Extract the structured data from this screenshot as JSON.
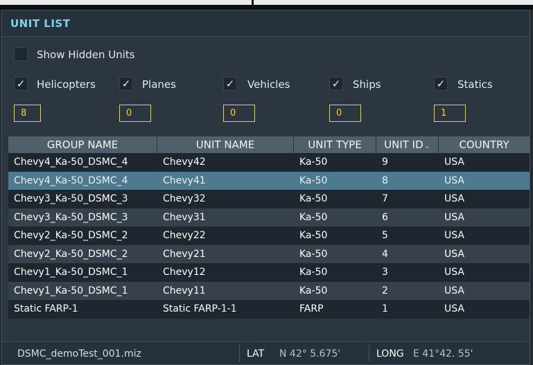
{
  "window": {
    "title": "UNIT LIST"
  },
  "filters": {
    "show_hidden": {
      "label": "Show Hidden Units",
      "checked": false
    },
    "categories": [
      {
        "label": "Helicopters",
        "checked": true,
        "count": "8"
      },
      {
        "label": "Planes",
        "checked": true,
        "count": "0"
      },
      {
        "label": "Vehicles",
        "checked": true,
        "count": "0"
      },
      {
        "label": "Ships",
        "checked": true,
        "count": "0"
      },
      {
        "label": "Statics",
        "checked": true,
        "count": "1"
      }
    ]
  },
  "table": {
    "columns": [
      "GROUP NAME",
      "UNIT NAME",
      "UNIT TYPE",
      "UNIT ID",
      "COUNTRY"
    ],
    "sort_indicator": "⌄",
    "rows": [
      [
        "Chevy4_Ka-50_DSMC_4",
        "Chevy42",
        "Ka-50",
        "9",
        "USA"
      ],
      [
        "Chevy4_Ka-50_DSMC_4",
        "Chevy41",
        "Ka-50",
        "8",
        "USA"
      ],
      [
        "Chevy3_Ka-50_DSMC_3",
        "Chevy32",
        "Ka-50",
        "7",
        "USA"
      ],
      [
        "Chevy3_Ka-50_DSMC_3",
        "Chevy31",
        "Ka-50",
        "6",
        "USA"
      ],
      [
        "Chevy2_Ka-50_DSMC_2",
        "Chevy22",
        "Ka-50",
        "5",
        "USA"
      ],
      [
        "Chevy2_Ka-50_DSMC_2",
        "Chevy21",
        "Ka-50",
        "4",
        "USA"
      ],
      [
        "Chevy1_Ka-50_DSMC_1",
        "Chevy12",
        "Ka-50",
        "3",
        "USA"
      ],
      [
        "Chevy1_Ka-50_DSMC_1",
        "Chevy11",
        "Ka-50",
        "2",
        "USA"
      ],
      [
        "Static FARP-1",
        "Static FARP-1-1",
        "FARP",
        "1",
        "USA"
      ]
    ],
    "selected_row": 1
  },
  "statusbar": {
    "mission_file": "DSMC_demoTest_001.miz",
    "lat_label": "LAT",
    "lat_value": "N 42° 5.675'",
    "long_label": "LONG",
    "long_value": "E 41°42. 55'"
  },
  "colors": {
    "title": "#7fd3ea",
    "count_border": "#ffd21a",
    "selected_row": "#4e7a8f"
  },
  "icons": {
    "checkbox_checked": "check-mark-icon"
  }
}
